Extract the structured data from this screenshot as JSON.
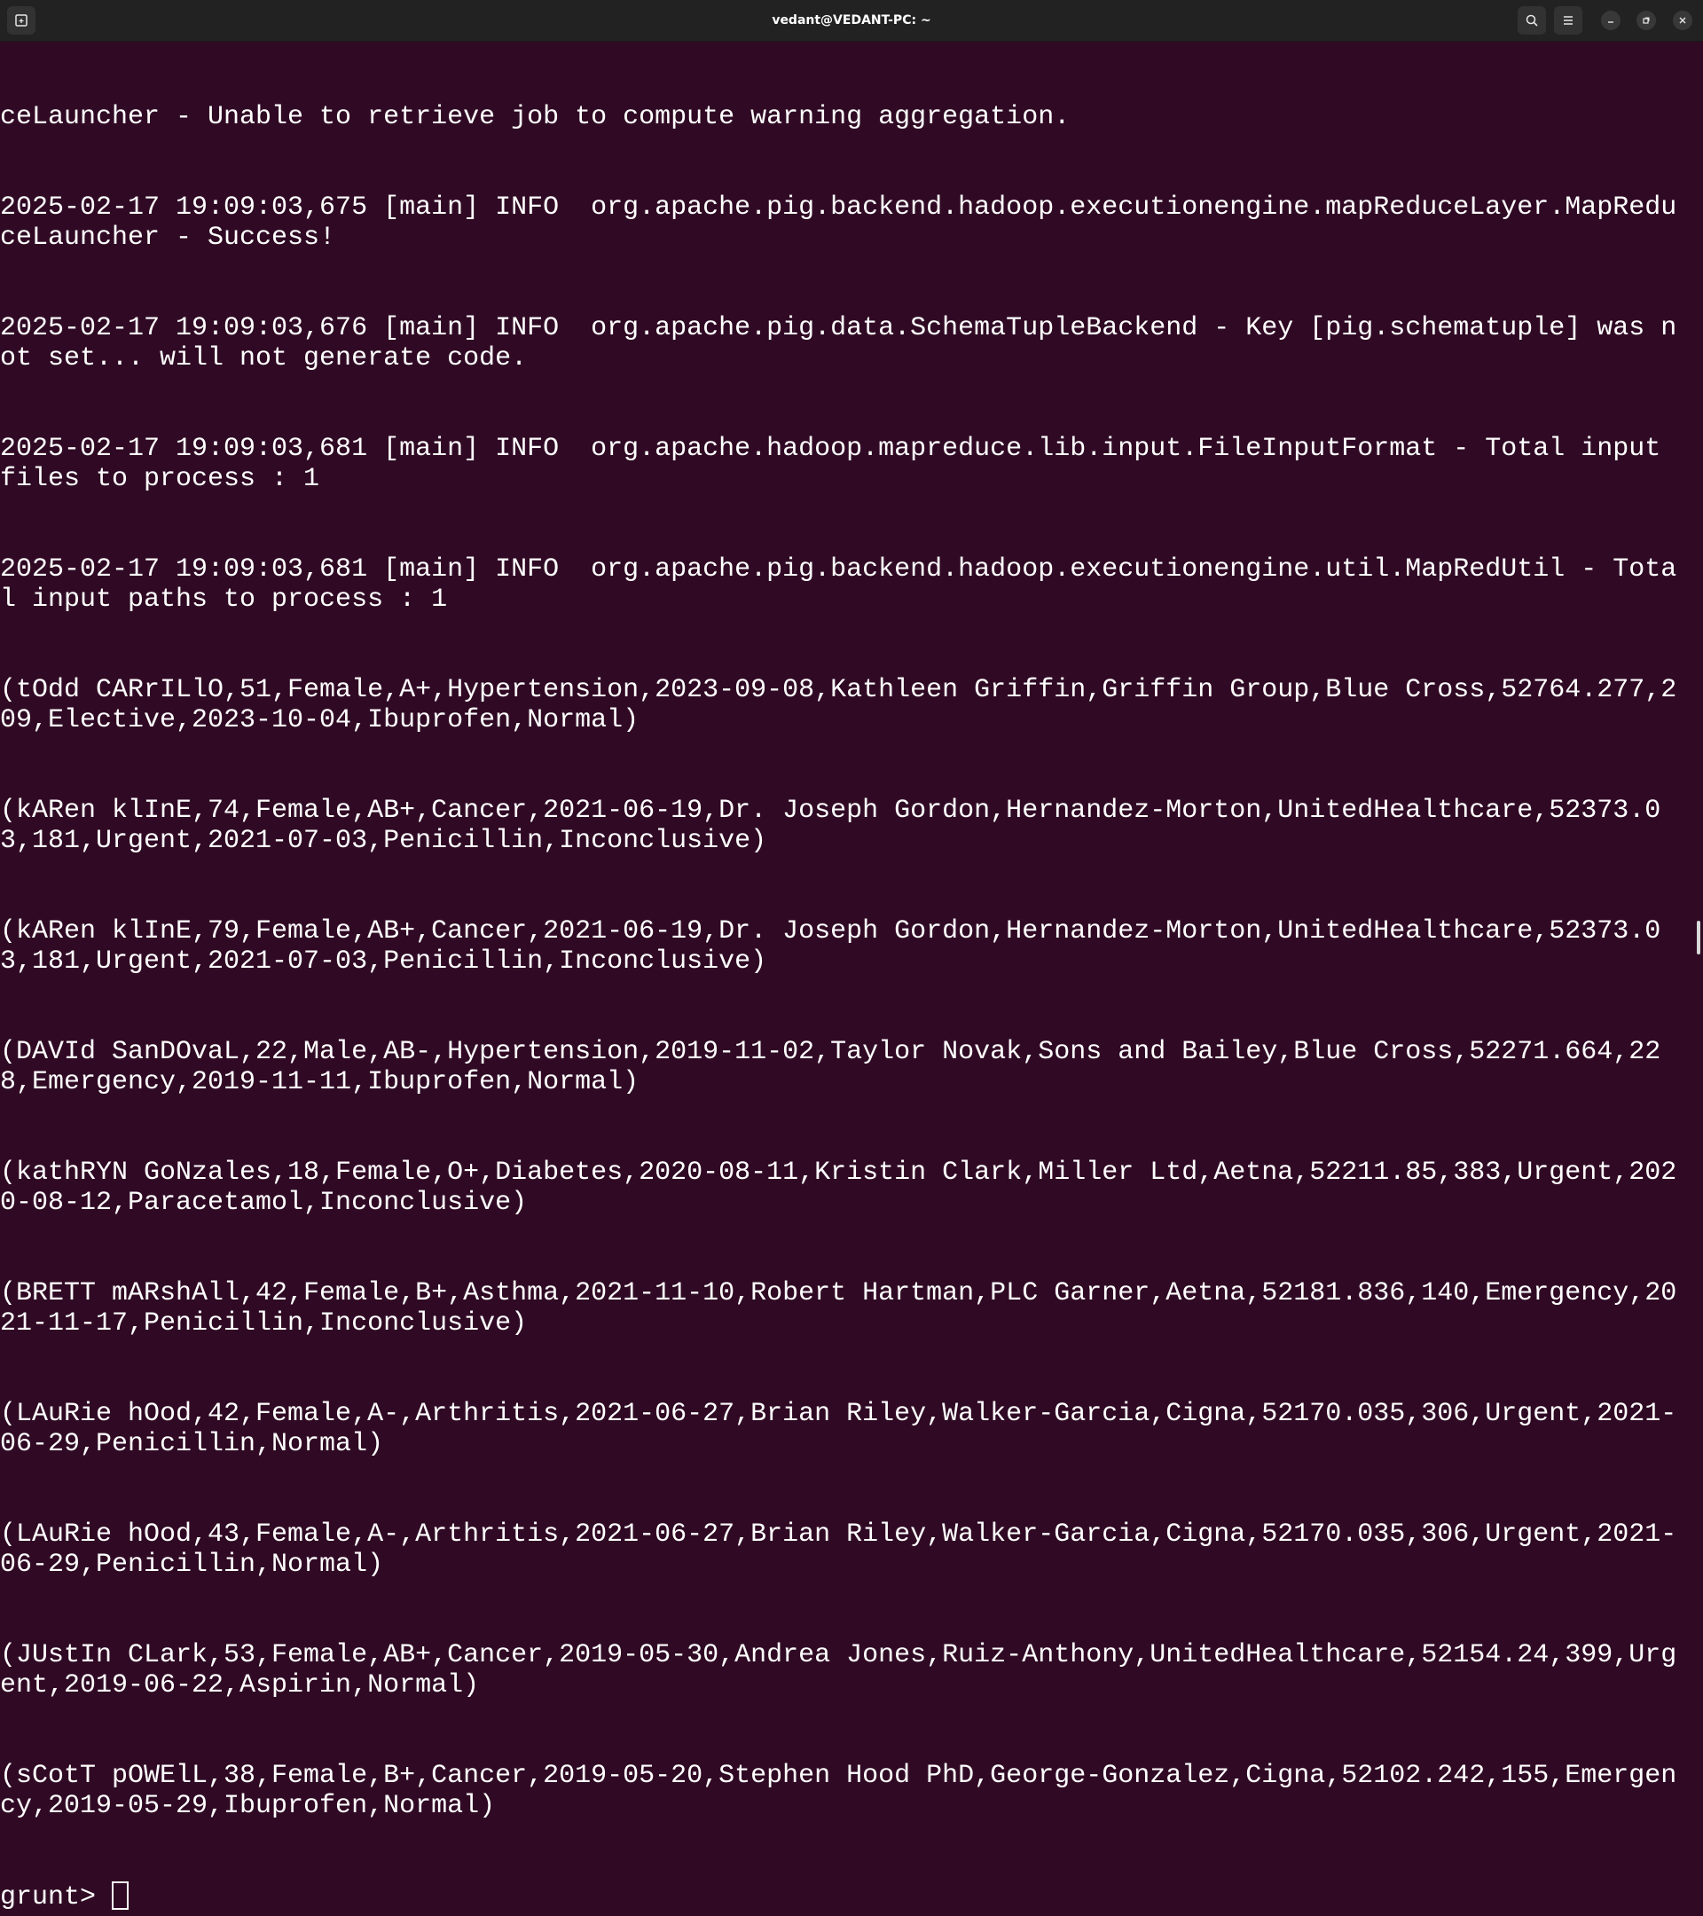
{
  "window": {
    "title": "vedant@VEDANT-PC: ~",
    "icons": [
      "new-tab-icon",
      "search-icon",
      "menu-icon",
      "minimize-icon",
      "maximize-icon",
      "close-icon"
    ]
  },
  "terminal": {
    "lines": [
      "ceLauncher - Unable to retrieve job to compute warning aggregation.",
      "2025-02-17 19:09:03,675 [main] INFO  org.apache.pig.backend.hadoop.executionengine.mapReduceLayer.MapReduceLauncher - Success!",
      "2025-02-17 19:09:03,676 [main] INFO  org.apache.pig.data.SchemaTupleBackend - Key [pig.schematuple] was not set... will not generate code.",
      "2025-02-17 19:09:03,681 [main] INFO  org.apache.hadoop.mapreduce.lib.input.FileInputFormat - Total input files to process : 1",
      "2025-02-17 19:09:03,681 [main] INFO  org.apache.pig.backend.hadoop.executionengine.util.MapRedUtil - Total input paths to process : 1",
      "(tOdd CARrILlO,51,Female,A+,Hypertension,2023-09-08,Kathleen Griffin,Griffin Group,Blue Cross,52764.277,209,Elective,2023-10-04,Ibuprofen,Normal)",
      "(kARen klInE,74,Female,AB+,Cancer,2021-06-19,Dr. Joseph Gordon,Hernandez-Morton,UnitedHealthcare,52373.03,181,Urgent,2021-07-03,Penicillin,Inconclusive)",
      "(kARen klInE,79,Female,AB+,Cancer,2021-06-19,Dr. Joseph Gordon,Hernandez-Morton,UnitedHealthcare,52373.03,181,Urgent,2021-07-03,Penicillin,Inconclusive)",
      "(DAVId SanDOvaL,22,Male,AB-,Hypertension,2019-11-02,Taylor Novak,Sons and Bailey,Blue Cross,52271.664,228,Emergency,2019-11-11,Ibuprofen,Normal)",
      "(kathRYN GoNzales,18,Female,O+,Diabetes,2020-08-11,Kristin Clark,Miller Ltd,Aetna,52211.85,383,Urgent,2020-08-12,Paracetamol,Inconclusive)",
      "(BRETT mARshAll,42,Female,B+,Asthma,2021-11-10,Robert Hartman,PLC Garner,Aetna,52181.836,140,Emergency,2021-11-17,Penicillin,Inconclusive)",
      "(LAuRie hOod,42,Female,A-,Arthritis,2021-06-27,Brian Riley,Walker-Garcia,Cigna,52170.035,306,Urgent,2021-06-29,Penicillin,Normal)",
      "(LAuRie hOod,43,Female,A-,Arthritis,2021-06-27,Brian Riley,Walker-Garcia,Cigna,52170.035,306,Urgent,2021-06-29,Penicillin,Normal)",
      "(JUstIn CLark,53,Female,AB+,Cancer,2019-05-30,Andrea Jones,Ruiz-Anthony,UnitedHealthcare,52154.24,399,Urgent,2019-06-22,Aspirin,Normal)",
      "(sCotT pOWElL,38,Female,B+,Cancer,2019-05-20,Stephen Hood PhD,George-Gonzalez,Cigna,52102.242,155,Emergency,2019-05-29,Ibuprofen,Normal)"
    ],
    "prompt": "grunt> ",
    "colors": {
      "background": "#300a24",
      "text": "#ffffff",
      "titlebar": "#222222"
    }
  }
}
